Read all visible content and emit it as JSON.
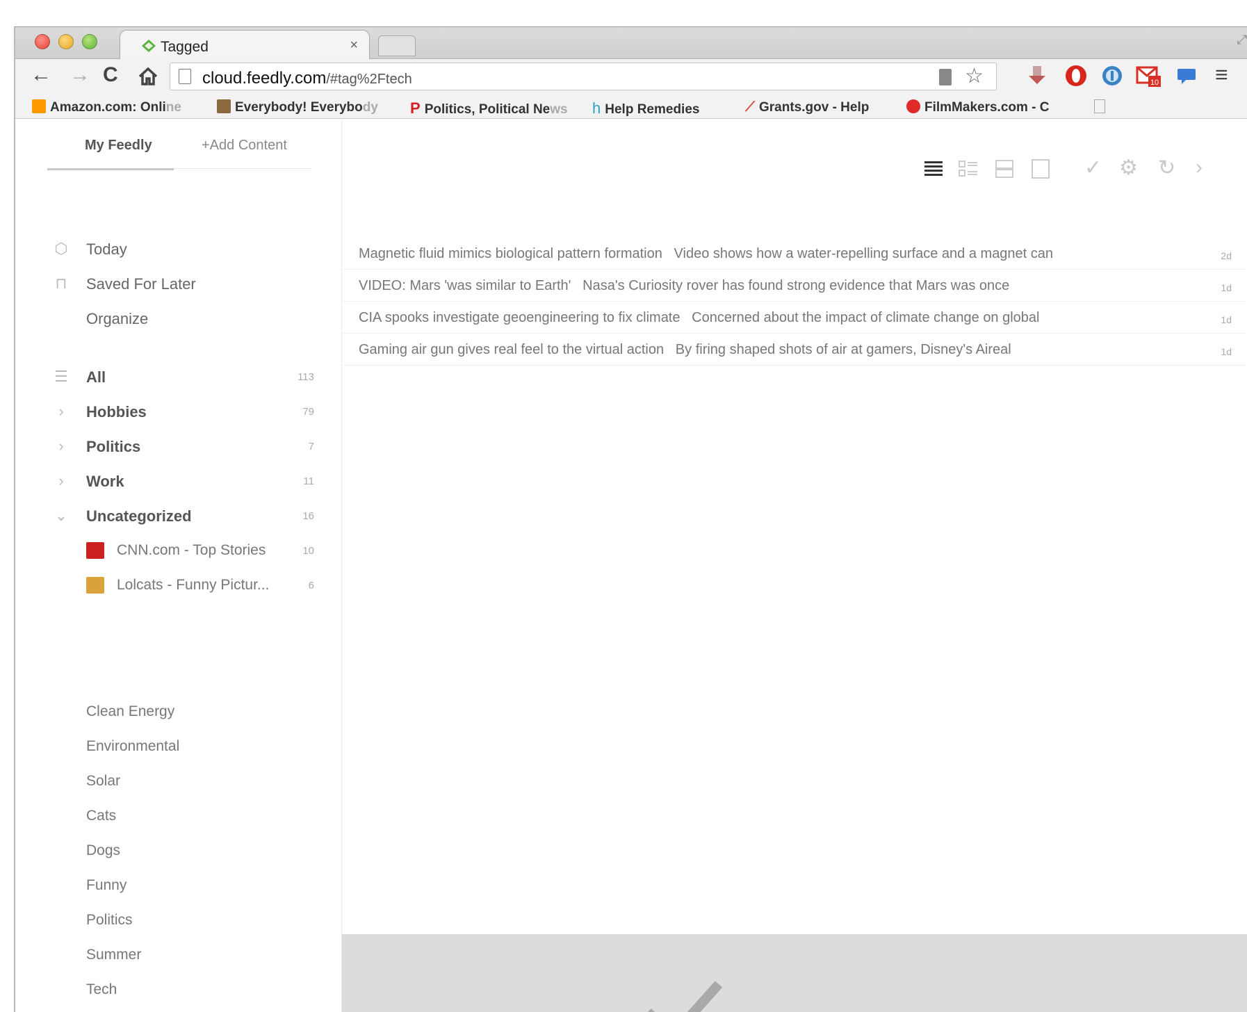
{
  "browser": {
    "tab_title": "Tagged",
    "tab_close": "×",
    "url_host": "cloud.feedly.com",
    "url_path": "/#tag%2Ftech",
    "bookmarks": [
      {
        "label": "Amazon.com: Onli",
        "fade": "ne",
        "icon": "amazon-icon"
      },
      {
        "label": "Everybody! Everybo",
        "fade": "dy",
        "icon": "everybody-icon"
      },
      {
        "label": "Politics, Political Ne",
        "fade": "ws",
        "icon": "politico-icon"
      },
      {
        "label": "Help Remedies",
        "fade": "",
        "icon": "help-remedies-icon"
      },
      {
        "label": "Grants.gov - Help",
        "fade": "",
        "icon": "grants-icon"
      },
      {
        "label": "FilmMakers.com - C",
        "fade": "",
        "icon": "filmmakers-icon"
      }
    ],
    "gmail_badge": "10",
    "colors": {
      "tab_favicon": "#56b33f",
      "opera": "#d9261c",
      "onepassword": "#3b82c4",
      "gmail": "#d93025",
      "chat": "#3a7bd5"
    }
  },
  "sidebar": {
    "tabs": {
      "my_feedly": "My Feedly",
      "add_content": "+Add Content"
    },
    "primary": [
      {
        "label": "Today",
        "icon": "today-icon"
      },
      {
        "label": "Saved For Later",
        "icon": "bookmark-icon"
      },
      {
        "label": "Organize",
        "icon": ""
      }
    ],
    "categories": [
      {
        "label": "All",
        "count": "113",
        "icon": "list-icon"
      },
      {
        "label": "Hobbies",
        "count": "79",
        "icon": "chevron-right-icon"
      },
      {
        "label": "Politics",
        "count": "7",
        "icon": "chevron-right-icon"
      },
      {
        "label": "Work",
        "count": "11",
        "icon": "chevron-right-icon"
      },
      {
        "label": "Uncategorized",
        "count": "16",
        "icon": "chevron-down-icon"
      }
    ],
    "feeds": [
      {
        "label": "CNN.com - Top Stories",
        "count": "10",
        "icon": "cnn-icon"
      },
      {
        "label": "Lolcats - Funny Pictur...",
        "count": "6",
        "icon": "lolcats-icon"
      }
    ],
    "tags": [
      "Clean Energy",
      "Environmental",
      "Solar",
      "Cats",
      "Dogs",
      "Funny",
      "Politics",
      "Summer",
      "Tech"
    ]
  },
  "main": {
    "entries": [
      {
        "title": "Magnetic fluid mimics biological pattern formation",
        "summary": "Video shows how a water-repelling surface and a magnet can",
        "age": "2d"
      },
      {
        "title": "VIDEO: Mars 'was similar to Earth'",
        "summary": "Nasa's Curiosity rover has found strong evidence that Mars was once",
        "age": "1d"
      },
      {
        "title": "CIA spooks investigate geoengineering to fix climate",
        "summary": "Concerned about the impact of climate change on global",
        "age": "1d"
      },
      {
        "title": "Gaming air gun gives real feel to the virtual action",
        "summary": "By firing shaped shots of air at gamers, Disney's Aireal",
        "age": "1d"
      }
    ]
  }
}
